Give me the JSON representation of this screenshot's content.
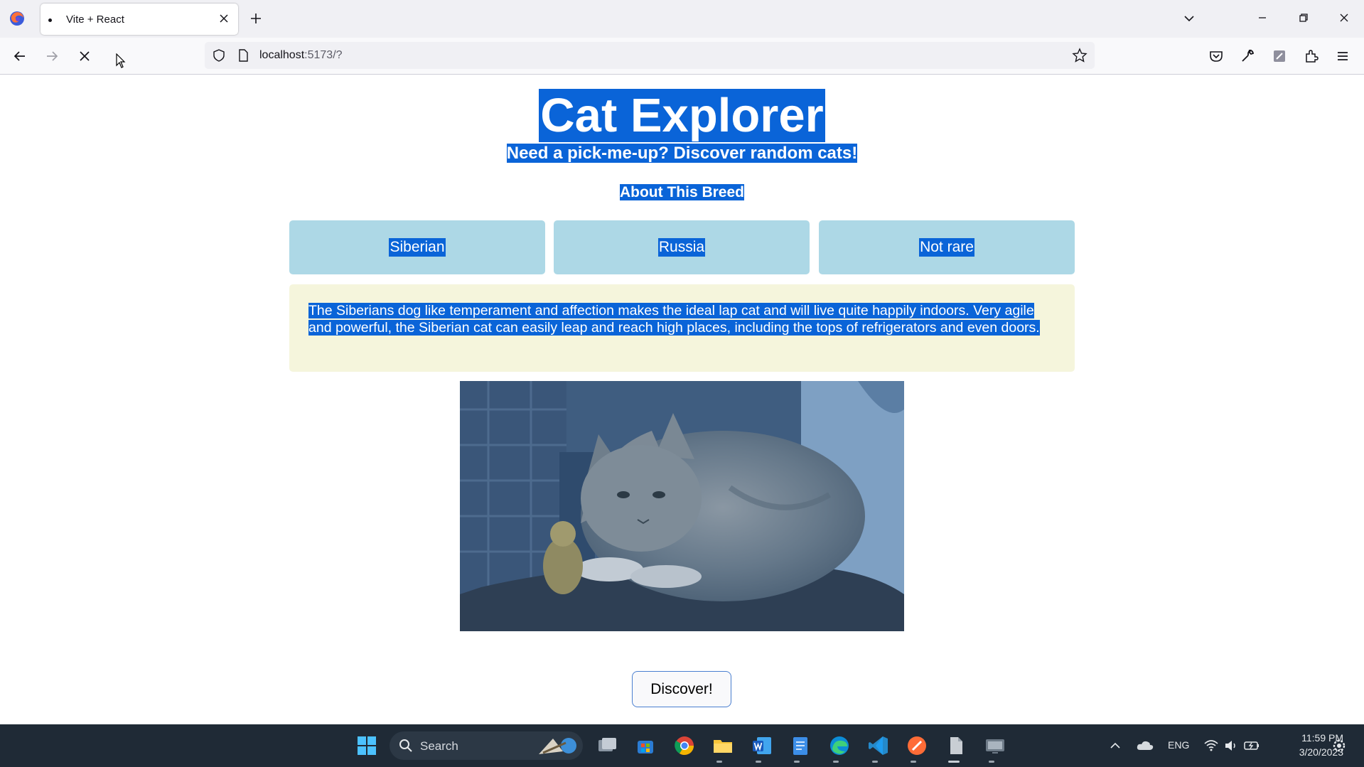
{
  "browser": {
    "tab_title": "Vite + React",
    "url_host": "localhost",
    "url_rest": ":5173/?"
  },
  "page": {
    "title": "Cat Explorer",
    "subtitle": "Need a pick-me-up? Discover random cats!",
    "section_heading": "About This Breed",
    "attributes": [
      "Siberian",
      "Russia",
      "Not rare"
    ],
    "description": "The Siberians dog like temperament and affection makes the ideal lap cat and will live quite happily indoors. Very agile and powerful, the Siberian cat can easily leap and reach high places, including the tops of refrigerators and even doors.",
    "discover_label": "Discover!"
  },
  "taskbar": {
    "search_placeholder": "Search",
    "language": "ENG",
    "time": "11:59 PM",
    "date": "3/20/2023"
  },
  "colors": {
    "selection": "#0a64d8",
    "attribute_bg": "#add8e6",
    "description_bg": "#f5f5dc",
    "taskbar_bg": "#1f2a36"
  },
  "icons": [
    "firefox-logo-icon",
    "close-icon",
    "plus-icon",
    "chevron-down-icon",
    "minimize-icon",
    "restore-icon",
    "back-arrow-icon",
    "forward-arrow-icon",
    "stop-icon",
    "shield-icon",
    "page-icon",
    "star-icon",
    "pocket-icon",
    "wrench-icon",
    "extension-icon",
    "menu-icon",
    "windows-start-icon",
    "search-icon"
  ]
}
